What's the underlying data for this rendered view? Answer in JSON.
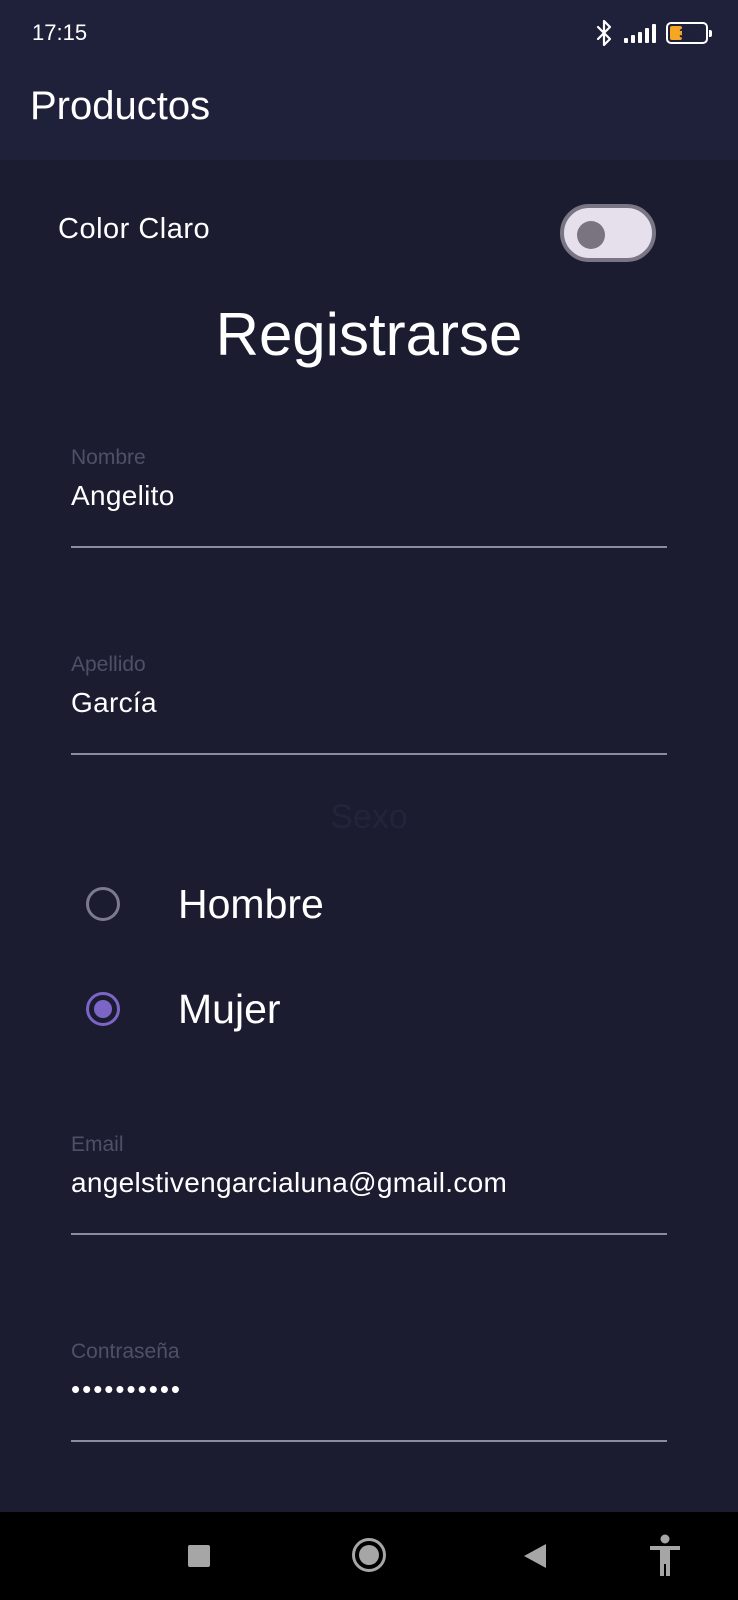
{
  "status_bar": {
    "time": "17:15",
    "battery_level": "38",
    "icons": [
      "bluetooth-icon",
      "signal-icon",
      "battery-icon"
    ]
  },
  "app_bar": {
    "title": "Productos"
  },
  "theme_toggle": {
    "label": "Color Claro",
    "checked": false
  },
  "form": {
    "title": "Registrarse",
    "fields": {
      "name": {
        "label": "Nombre",
        "value": "Angelito"
      },
      "lastname": {
        "label": "Apellido",
        "value": "García"
      },
      "email": {
        "label": "Email",
        "value": "angelstivengarcialuna@gmail.com"
      },
      "password": {
        "label": "Contraseña",
        "value": "••••••••••"
      }
    },
    "sex": {
      "label": "Sexo",
      "options": [
        {
          "label": "Hombre",
          "selected": false
        },
        {
          "label": "Mujer",
          "selected": true
        }
      ]
    }
  },
  "nav_bar": {
    "buttons": [
      "recents-icon",
      "home-icon",
      "back-icon",
      "accessibility-icon"
    ]
  },
  "colors": {
    "background": "#1b1c30",
    "app_bar": "#1f2039",
    "accent": "#7d65c7",
    "label": "#4f5066",
    "text": "#ffffff"
  }
}
